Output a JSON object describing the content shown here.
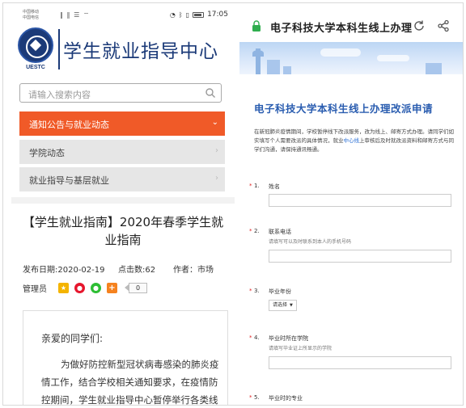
{
  "left": {
    "status": {
      "carrier1": "中国移动",
      "carrier2": "中国电信",
      "signal_icons": "‖ ‖ ☰ ⌔",
      "time": "17:05"
    },
    "logo_text": "UESTC",
    "site_title": "学生就业指导中心",
    "search_placeholder": "请输入搜索内容",
    "menu": [
      {
        "label": "通知公告与就业动态",
        "chevron": "⌄"
      },
      {
        "label": "学院动态",
        "chevron": "›"
      },
      {
        "label": "就业指导与基层就业",
        "chevron": "›"
      }
    ],
    "article": {
      "title": "【学生就业指南】2020年春季学生就业指南",
      "date": "发布日期:2020-02-19",
      "clicks": "点击数:62",
      "author": "作者：市场",
      "admin": "管理员",
      "share_count": "0",
      "greeting": "亲爱的同学们:",
      "body": "为做好防控新型冠状病毒感染的肺炎疫情工作，结合学校相关通知要求，在疫情防控期间，学生就业指导中心暂停举行各类线"
    }
  },
  "right": {
    "page_title": "电子科技大学本科生线上办理",
    "form_title": "电子科技大学本科生线上办理改派申请",
    "intro_before": "在新冠肺炎疫情期间，学校暂停线下改派服务，改为线上、邮寄方式办理。请同学们如实填写个人需要改派的具体情况，就业",
    "intro_link": "中心线",
    "intro_after": "上审核后及时就改派资料和邮寄方式与同学们沟通，请保持通讯畅通。",
    "questions": [
      {
        "star": "*",
        "num": "1.",
        "label": "姓名",
        "hint": ""
      },
      {
        "star": "*",
        "num": "2.",
        "label": "联系电话",
        "hint": "请填写可以及时联系到本人的手机号码"
      },
      {
        "star": "*",
        "num": "3.",
        "label": "毕业年份",
        "hint": "",
        "select_value": "请选择"
      },
      {
        "star": "*",
        "num": "4.",
        "label": "毕业时所在学院",
        "hint": "请填写毕业证上所显示的学院"
      },
      {
        "star": "*",
        "num": "5.",
        "label": "毕业时的专业",
        "hint": ""
      }
    ]
  },
  "colors": {
    "accent_orange": "#f05a28",
    "brand_blue": "#1b3a78",
    "form_title_blue": "#2a5db0"
  }
}
